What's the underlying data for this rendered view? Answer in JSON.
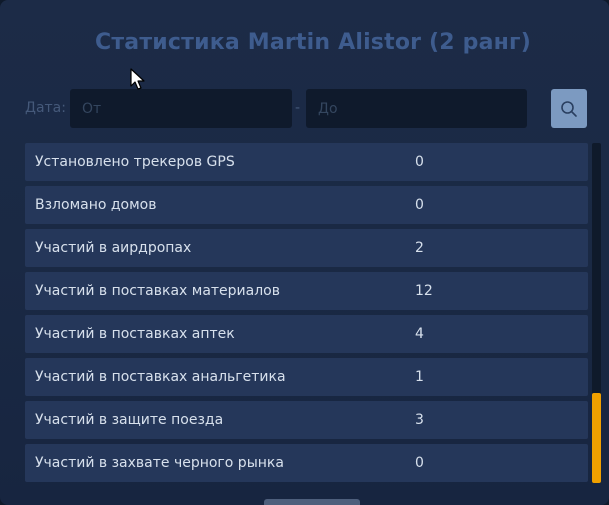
{
  "title": "Статистика Martin Alistor (2 ранг)",
  "filter": {
    "label": "Дата:",
    "from_placeholder": "От",
    "to_placeholder": "До",
    "separator": "-"
  },
  "icons": {
    "search": "search-icon"
  },
  "stats": [
    {
      "label": "Установлено трекеров GPS",
      "value": "0"
    },
    {
      "label": "Взломано домов",
      "value": "0"
    },
    {
      "label": "Участий в аирдропах",
      "value": "2"
    },
    {
      "label": "Участий в поставках материалов",
      "value": "12"
    },
    {
      "label": "Участий в поставках аптек",
      "value": "4"
    },
    {
      "label": "Участий в поставках анальгетика",
      "value": "1"
    },
    {
      "label": "Участий в защите поезда",
      "value": "3"
    },
    {
      "label": "Участий в захвате черного рынка",
      "value": "0"
    }
  ],
  "colors": {
    "accent_scrollbar": "#f0a000",
    "search_button": "#7c9ac1",
    "title": "#3e5c8e"
  }
}
